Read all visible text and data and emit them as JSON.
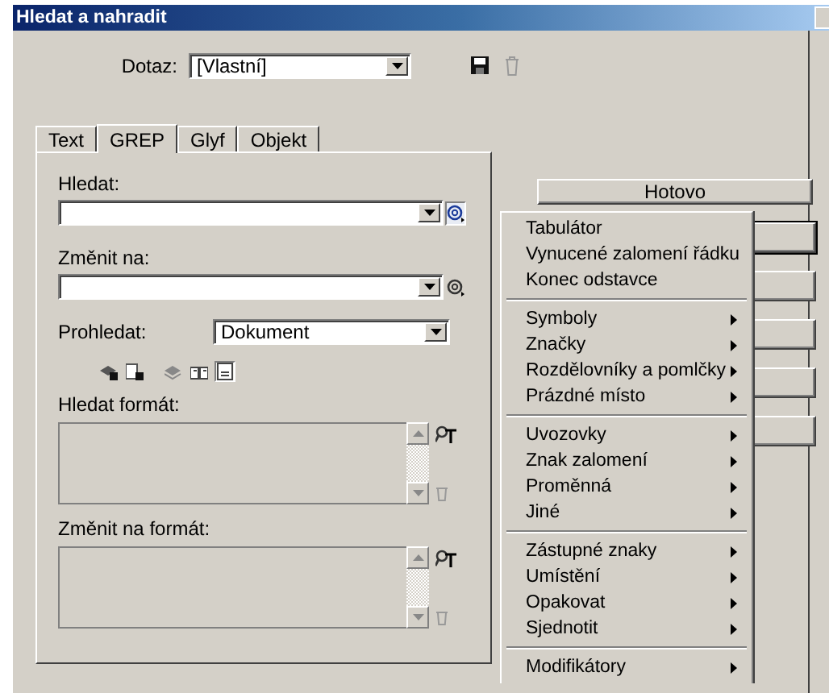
{
  "window": {
    "title": "Hledat a nahradit"
  },
  "query": {
    "label": "Dotaz:",
    "value": "[Vlastní]"
  },
  "tabs": [
    {
      "label": "Text",
      "selected": false
    },
    {
      "label": "GREP",
      "selected": true
    },
    {
      "label": "Glyf",
      "selected": false
    },
    {
      "label": "Objekt",
      "selected": false
    }
  ],
  "find": {
    "label": "Hledat:",
    "special_pressed": true
  },
  "change": {
    "label": "Změnit na:",
    "special_pressed": false
  },
  "search_in": {
    "label": "Prohledat:",
    "value": "Dokument"
  },
  "search_options": [
    {
      "selected": false
    },
    {
      "selected": false
    },
    {
      "selected": false
    },
    {
      "selected": false
    },
    {
      "selected": true
    }
  ],
  "find_format": {
    "label": "Hledat formát:"
  },
  "change_format": {
    "label": "Změnit na formát:"
  },
  "done_button": {
    "label": "Hotovo"
  },
  "special_menu": {
    "groups": [
      [
        {
          "label": "Tabulátor",
          "submenu": false
        },
        {
          "label": "Vynucené zalomení řádku",
          "submenu": false
        },
        {
          "label": "Konec odstavce",
          "submenu": false
        }
      ],
      [
        {
          "label": "Symboly",
          "submenu": true
        },
        {
          "label": "Značky",
          "submenu": true
        },
        {
          "label": "Rozdělovníky a pomlčky",
          "submenu": true
        },
        {
          "label": "Prázdné místo",
          "submenu": true
        }
      ],
      [
        {
          "label": "Uvozovky",
          "submenu": true
        },
        {
          "label": "Znak zalomení",
          "submenu": true
        },
        {
          "label": "Proměnná",
          "submenu": true
        },
        {
          "label": "Jiné",
          "submenu": true
        }
      ],
      [
        {
          "label": "Zástupné znaky",
          "submenu": true
        },
        {
          "label": "Umístění",
          "submenu": true
        },
        {
          "label": "Opakovat",
          "submenu": true
        },
        {
          "label": "Sjednotit",
          "submenu": true
        }
      ],
      [
        {
          "label": "Modifikátory",
          "submenu": true
        }
      ]
    ]
  }
}
